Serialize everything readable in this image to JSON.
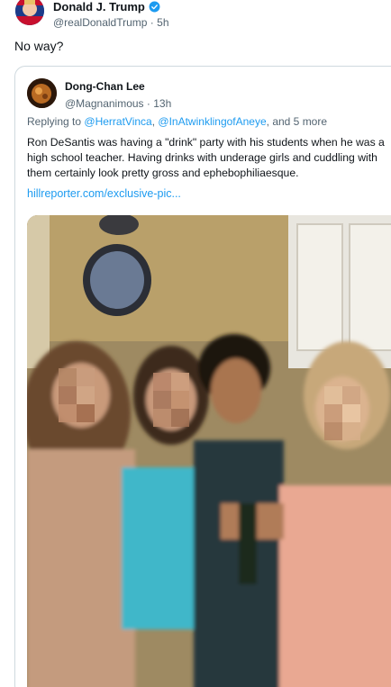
{
  "post": {
    "author_name": "Donald J. Trump",
    "author_handle": "@realDonaldTrump",
    "time_separator": "·",
    "time": "5h",
    "text": "No way?"
  },
  "quoted": {
    "author_name": "Dong-Chan Lee",
    "author_handle": "@Magnanimous",
    "time_separator": "·",
    "time": "13h",
    "replying_prefix": "Replying to",
    "reply_mention_1": "@HerratVinca",
    "reply_sep": ",",
    "reply_mention_2": "@InAtwinklingofAneye",
    "reply_suffix": ", and 5 more",
    "text": "Ron DeSantis was having a \"drink\" party with his students when he was a high school teacher. Having drinks with underage girls and cuddling with them certainly look pretty gross and ephebophiliaesque.",
    "link": "hillreporter.com/exclusive-pic..."
  },
  "colors": {
    "link": "#1d9bf0",
    "verified": "#1d9bf0",
    "secondary_text": "#536471",
    "border": "#cfd9de"
  },
  "icons": {
    "verified": "verified-badge-icon"
  }
}
